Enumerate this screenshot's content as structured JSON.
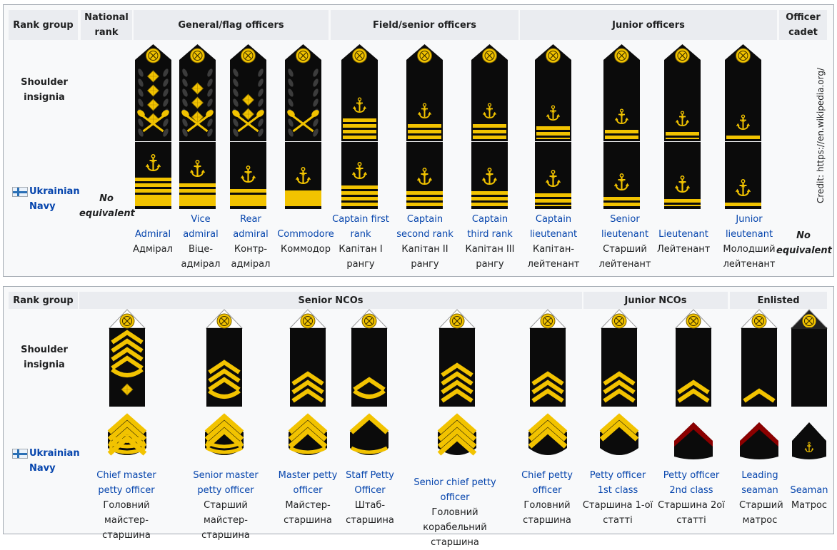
{
  "officers": {
    "headers": {
      "rank_group": "Rank group",
      "national_rank": "National rank",
      "general": "General/flag officers",
      "field": "Field/senior officers",
      "junior": "Junior officers",
      "cadet": "Officer cadet"
    },
    "row_label": "Shoulder insignia",
    "navy_label": "Ukrainian Navy",
    "no_equivalent_left": "No equivalent",
    "no_equivalent_right": "No equivalent",
    "credit": "Credit: https://en.wikipedia.org/",
    "ranks": [
      {
        "en": "Admiral",
        "uk": "Адмірал"
      },
      {
        "en": "Vice admiral",
        "uk": "Віце-адмірал"
      },
      {
        "en": "Rear admiral",
        "uk": "Контр-адмірал"
      },
      {
        "en": "Commodore",
        "uk": "Коммодор"
      },
      {
        "en": "Captain first rank",
        "uk": "Капітан I рангу"
      },
      {
        "en": "Captain second rank",
        "uk": "Капітан II рангу"
      },
      {
        "en": "Captain third rank",
        "uk": "Капітан III рангу"
      },
      {
        "en": "Captain lieutenant",
        "uk": "Капітан-лейтенант"
      },
      {
        "en": "Senior lieutenant",
        "uk": "Старший лейтенант"
      },
      {
        "en": "Lieutenant",
        "uk": "Лейтенант"
      },
      {
        "en": "Junior lieutenant",
        "uk": "Молодший лейтенант"
      }
    ]
  },
  "enlisted": {
    "headers": {
      "rank_group": "Rank group",
      "senior_ncos": "Senior NCOs",
      "junior_ncos": "Junior NCOs",
      "enlisted": "Enlisted"
    },
    "row_label": "Shoulder insignia",
    "navy_label": "Ukrainian Navy",
    "ranks": [
      {
        "en": "Chief master petty officer",
        "uk": "Головний майстер-старшина"
      },
      {
        "en": "Senior master petty officer",
        "uk": "Старший майстер-старшина"
      },
      {
        "en": "Master petty officer",
        "uk": "Майстер-старшина"
      },
      {
        "en": "Staff Petty Officer",
        "uk": "Штаб-старшина"
      },
      {
        "en": "Senior chief petty officer",
        "uk": "Головний корабельний старшина"
      },
      {
        "en": "Chief petty officer",
        "uk": "Головний старшина"
      },
      {
        "en": "Petty officer 1st class",
        "uk": "Старшина 1-ої статті"
      },
      {
        "en": "Petty officer 2nd class",
        "uk": "Старшина 2ої статті"
      },
      {
        "en": "Leading seaman",
        "uk": "Старший матрос"
      },
      {
        "en": "Seaman",
        "uk": "Матрос"
      }
    ]
  },
  "colors": {
    "gold": "#f2c300",
    "black": "#0b0b0b",
    "link": "#0645ad",
    "header_bg": "#eaecf0",
    "border": "#a2a9b1"
  }
}
